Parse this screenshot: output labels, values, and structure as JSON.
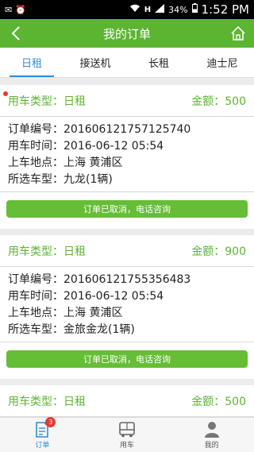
{
  "status_bar": {
    "network": "H",
    "battery": "34%",
    "time": "1:52 PM"
  },
  "header": {
    "title": "我的订单"
  },
  "tabs": [
    {
      "label": "日租",
      "active": true
    },
    {
      "label": "接送机",
      "active": false
    },
    {
      "label": "长租",
      "active": false
    },
    {
      "label": "迪士尼",
      "active": false
    }
  ],
  "orders": [
    {
      "type": "用车类型：日租",
      "amount": "金额：500",
      "order_no": "订单编号：201606121757125740",
      "time": "用车时间：2016-06-12 05:54",
      "location": "上车地点：上海 黄浦区",
      "car": "所选车型：九龙(1辆)",
      "button": "订单已取消，电话咨询",
      "unread": true
    },
    {
      "type": "用车类型：日租",
      "amount": "金额：900",
      "order_no": "订单编号：201606121755356483",
      "time": "用车时间：2016-06-12 05:54",
      "location": "上车地点：上海 黄浦区",
      "car": "所选车型：金旅金龙(1辆)",
      "button": "订单已取消，电话咨询",
      "unread": false
    },
    {
      "type": "用车类型：日租",
      "amount": "金额：500",
      "unread": false
    }
  ],
  "tabbar": {
    "items": [
      {
        "label": "订单",
        "icon": "order-icon",
        "badge": "3",
        "active": true
      },
      {
        "label": "用车",
        "icon": "bus-icon",
        "active": false
      },
      {
        "label": "我的",
        "icon": "person-icon",
        "active": false
      }
    ]
  },
  "colors": {
    "brand_green": "#5cb531",
    "active_blue": "#2a8fd6",
    "badge_red": "#e53935"
  }
}
